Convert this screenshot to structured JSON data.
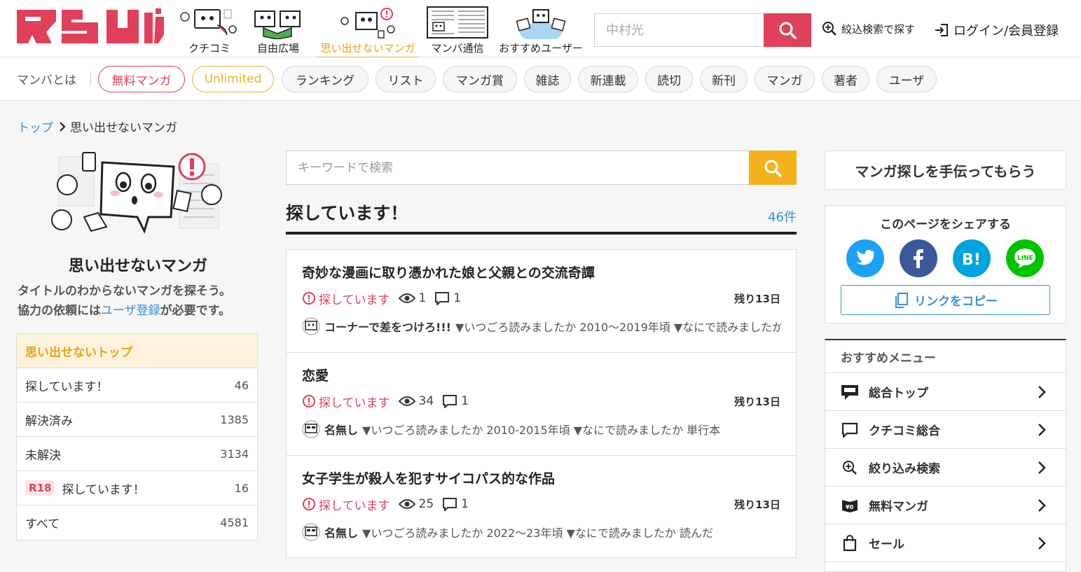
{
  "header": {
    "nav": [
      {
        "label": "クチコミ",
        "icon": "kuchikomi-icon"
      },
      {
        "label": "自由広場",
        "icon": "jiyu-hiroba-icon"
      },
      {
        "label": "思い出せないマンガ",
        "icon": "omoidasenai-icon",
        "active": true
      },
      {
        "label": "マンバ通信",
        "icon": "manba-tsushin-icon"
      },
      {
        "label": "おすすめユーザー",
        "icon": "recommended-users-icon"
      }
    ],
    "search_placeholder": "中村光",
    "filter_search": "絞込検索で探す",
    "login": "ログイン/会員登録",
    "accent": "#e0405a"
  },
  "catbar": {
    "about": "マンバとは",
    "pills": [
      "無料マンガ",
      "Unlimited",
      "ランキング",
      "リスト",
      "マンガ賞",
      "雑誌",
      "新連載",
      "読切",
      "新刊",
      "マンガ",
      "著者",
      "ユーザ"
    ]
  },
  "breadcrumb": {
    "home": "トップ",
    "current": "思い出せないマンガ"
  },
  "left": {
    "title": "思い出せないマンガ",
    "desc_line1": "タイトルのわからないマンガを探そう。",
    "desc_prefix": "協力の依頼には",
    "desc_link": "ユーザ登録",
    "desc_suffix": "が必要です。",
    "menu_head": "思い出せないトップ",
    "menu": [
      {
        "label": "探しています！",
        "count": "46"
      },
      {
        "label": "解決済み",
        "count": "1385"
      },
      {
        "label": "未解決",
        "count": "3134"
      },
      {
        "badge": "R18",
        "label": "探しています！",
        "count": "16"
      },
      {
        "label": "すべて",
        "count": "4581"
      }
    ]
  },
  "center": {
    "search_placeholder": "キーワードで検索",
    "section_title": "探しています！",
    "section_count": "46件",
    "posts": [
      {
        "title": "奇妙な漫画に取り憑かれた娘と父親との交流奇譚",
        "status": "探しています",
        "views": "1",
        "comments": "1",
        "remaining": "残り13日",
        "author": "コーナーで差をつけろ!!!",
        "excerpt": "▼いつごろ読みましたか 2010〜2019年頃 ▼なにで読みましたか"
      },
      {
        "title": "恋愛",
        "status": "探しています",
        "views": "34",
        "comments": "1",
        "remaining": "残り13日",
        "author": "名無し",
        "excerpt": "▼いつごろ読みましたか 2010-2015年頃 ▼なにで読みましたか 単行本"
      },
      {
        "title": "女子学生が殺人を犯すサイコパス的な作品",
        "status": "探しています",
        "views": "25",
        "comments": "1",
        "remaining": "残り13日",
        "author": "名無し",
        "excerpt": "▼いつごろ読みましたか 2022〜23年頃 ▼なにで読みましたか 読んだ"
      }
    ]
  },
  "right": {
    "help": "マンガ探しを手伝ってもらう",
    "share_title": "このページをシェアする",
    "share": [
      {
        "name": "twitter",
        "color": "#1da1f2"
      },
      {
        "name": "facebook",
        "color": "#3b5998"
      },
      {
        "name": "hatena",
        "color": "#00a4de"
      },
      {
        "name": "line",
        "color": "#00c300"
      }
    ],
    "copy_link": "リンクをコピー",
    "rec_head": "おすすめメニュー",
    "rec": [
      {
        "label": "総合トップ",
        "icon": "top-icon"
      },
      {
        "label": "クチコミ総合",
        "icon": "comment-icon"
      },
      {
        "label": "絞り込み検索",
        "icon": "zoom-search-icon"
      },
      {
        "label": "無料マンガ",
        "icon": "free-manga-icon"
      },
      {
        "label": "セール",
        "icon": "sale-bag-icon"
      }
    ]
  }
}
